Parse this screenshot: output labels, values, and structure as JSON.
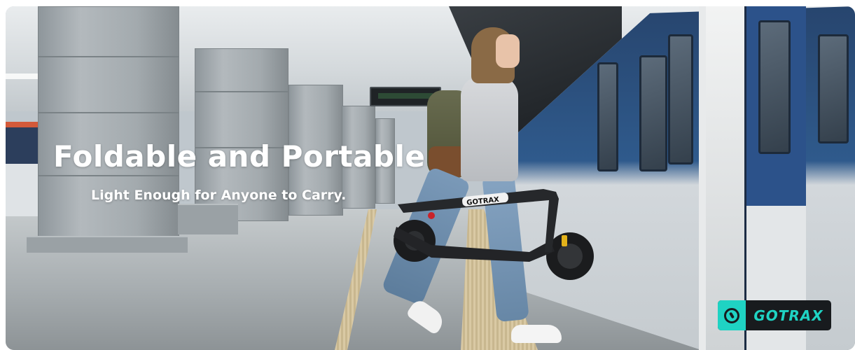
{
  "banner": {
    "headline": "Foldable and Portable",
    "subheadline": "Light Enough for Anyone to Carry.",
    "scooter_handle_text": "GOTRAX",
    "logo": {
      "text": "GOTRAX",
      "icon": "gotrax-logo-icon",
      "accent_color": "#1fd3c3",
      "background_color": "#181b1e"
    }
  }
}
